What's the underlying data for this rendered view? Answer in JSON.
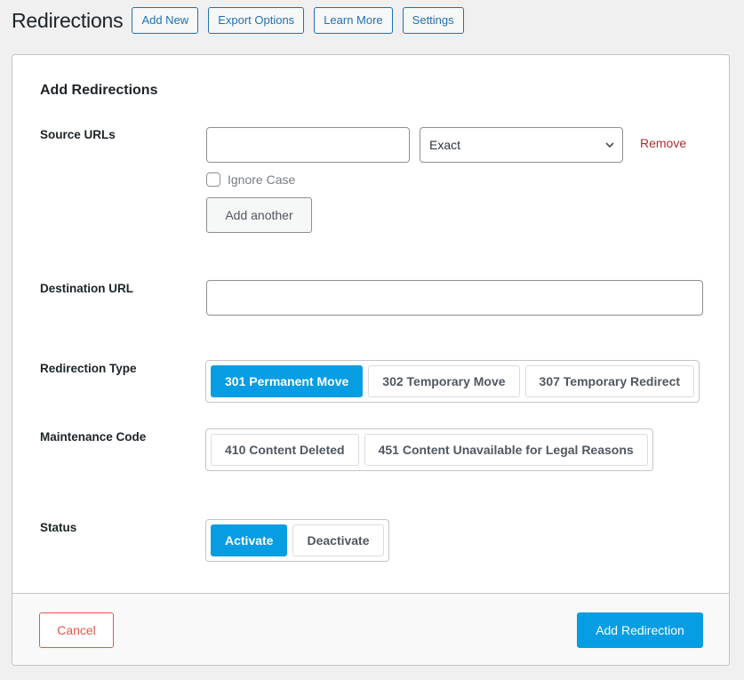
{
  "header": {
    "title": "Redirections",
    "buttons": [
      "Add New",
      "Export Options",
      "Learn More",
      "Settings"
    ]
  },
  "form": {
    "title": "Add Redirections",
    "source_urls": {
      "label": "Source URLs",
      "value": "",
      "match_type": "Exact",
      "remove_label": "Remove",
      "ignore_case_label": "Ignore Case",
      "ignore_case_checked": false,
      "add_another_label": "Add another"
    },
    "destination": {
      "label": "Destination URL",
      "value": ""
    },
    "redirection_type": {
      "label": "Redirection Type",
      "options": [
        "301 Permanent Move",
        "302 Temporary Move",
        "307 Temporary Redirect"
      ],
      "selected": "301 Permanent Move"
    },
    "maintenance_code": {
      "label": "Maintenance Code",
      "options": [
        "410 Content Deleted",
        "451 Content Unavailable for Legal Reasons"
      ],
      "selected": null
    },
    "status": {
      "label": "Status",
      "options": [
        "Activate",
        "Deactivate"
      ],
      "selected": "Activate"
    },
    "footer": {
      "cancel_label": "Cancel",
      "submit_label": "Add Redirection"
    }
  },
  "colors": {
    "accent": "#069de3",
    "link": "#2271b1",
    "danger": "#b32d2e",
    "cancel": "#e2574c"
  }
}
